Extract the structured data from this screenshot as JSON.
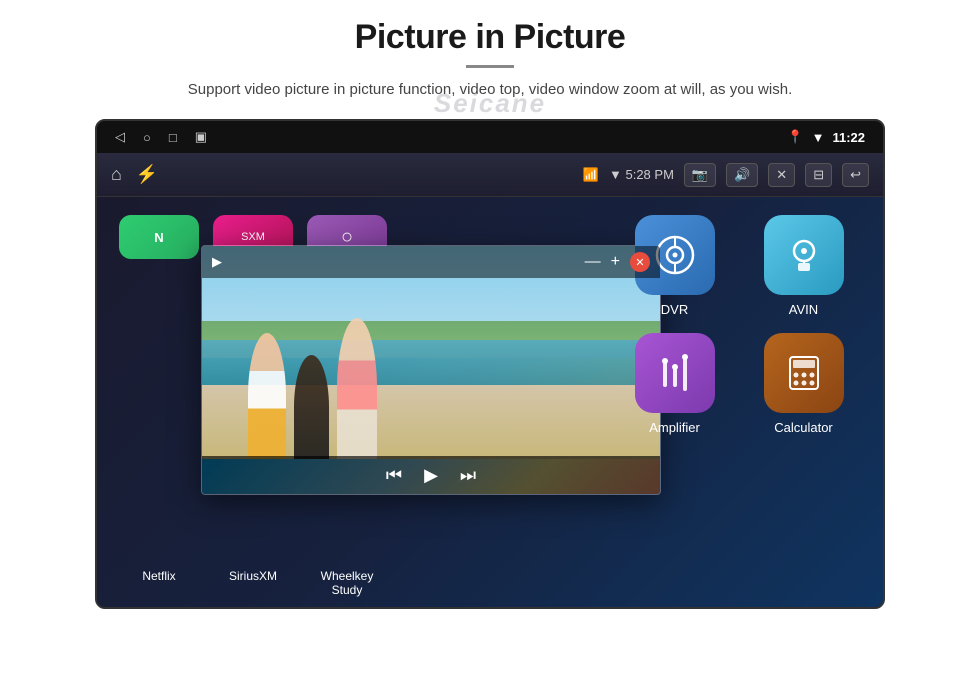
{
  "page": {
    "title": "Picture in Picture",
    "watermark": "Seicane",
    "subtitle": "Support video picture in picture function, video top, video window zoom at will, as you wish."
  },
  "status_bar": {
    "nav_back": "◁",
    "nav_home": "○",
    "nav_recent": "□",
    "nav_screenshot": "▣",
    "wifi": "▼",
    "time": "11:22"
  },
  "toolbar": {
    "home_icon": "⌂",
    "usb_icon": "⚡",
    "wifi_label": "▼ 5:28 PM",
    "camera_icon": "📷",
    "volume_icon": "🔊",
    "close_icon": "✕",
    "window_icon": "⊟",
    "back_icon": "↩"
  },
  "pip_window": {
    "play_icon": "▶",
    "minimize_icon": "—",
    "expand_icon": "+",
    "close_icon": "✕",
    "prev_icon": "⏮",
    "play_pause_icon": "▶",
    "next_icon": "⏭"
  },
  "apps": {
    "top_row": [
      {
        "id": "netflix",
        "label": "Netflix",
        "color": "#2ecc71"
      },
      {
        "id": "siriusxm",
        "label": "SiriusXM",
        "color": "#e91e8c"
      },
      {
        "id": "wheelkey",
        "label": "Wheelkey Study",
        "color": "#9b59b6"
      }
    ],
    "right_grid": [
      {
        "id": "dvr",
        "label": "DVR",
        "icon": "📡",
        "bg_class": "app-icon-dvr"
      },
      {
        "id": "avin",
        "label": "AVIN",
        "icon": "🎬",
        "bg_class": "app-icon-avin"
      },
      {
        "id": "amplifier",
        "label": "Amplifier",
        "icon": "🎚",
        "bg_class": "app-icon-amplifier"
      },
      {
        "id": "calculator",
        "label": "Calculator",
        "icon": "🧮",
        "bg_class": "app-icon-calculator"
      }
    ]
  }
}
